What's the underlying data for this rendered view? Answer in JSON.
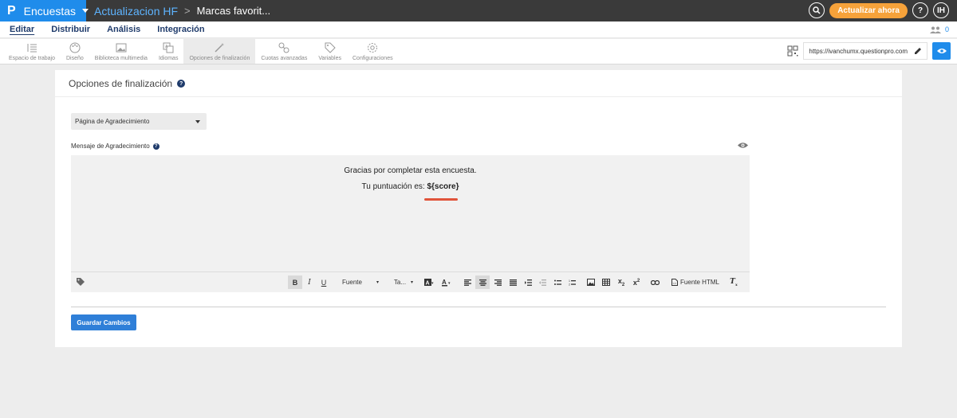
{
  "topbar": {
    "brand_logo": "P",
    "brand_name": "Encuestas",
    "breadcrumb_link": "Actualizacion HF",
    "breadcrumb_sep": ">",
    "breadcrumb_current": "Marcas favorit...",
    "search_icon": "search-icon",
    "update_label": "Actualizar ahora",
    "help_label": "?",
    "avatar_initials": "IH"
  },
  "menu": {
    "items": [
      {
        "label": "Editar",
        "active": true
      },
      {
        "label": "Distribuir",
        "active": false
      },
      {
        "label": "Análisis",
        "active": false
      },
      {
        "label": "Integración",
        "active": false
      }
    ],
    "users_count": "0"
  },
  "toolbar": {
    "tools": [
      {
        "label": "Espacio de trabajo",
        "icon": "workspace-icon"
      },
      {
        "label": "Diseño",
        "icon": "palette-icon"
      },
      {
        "label": "Biblioteca multimedia",
        "icon": "image-icon"
      },
      {
        "label": "Idiomas",
        "icon": "language-icon"
      },
      {
        "label": "Opciones de finalización",
        "icon": "wand-icon",
        "active": true
      },
      {
        "label": "Cuotas avanzadas",
        "icon": "quota-icon"
      },
      {
        "label": "Variables",
        "icon": "tag-icon"
      },
      {
        "label": "Configuraciones",
        "icon": "gear-icon"
      }
    ],
    "url": "https://ivanchumx.questionpro.com"
  },
  "panel": {
    "title": "Opciones de finalización",
    "select_value": "Página de Agradecimiento",
    "message_label": "Mensaje de Agradecimiento",
    "editor_line1": "Gracias por completar esta encuesta.",
    "editor_line2_prefix": "Tu puntuación es: ",
    "editor_line2_var": "${score}",
    "font_label": "Fuente",
    "size_label": "Ta...",
    "html_source_label": "Fuente HTML",
    "save_label": "Guardar Cambios"
  },
  "colors": {
    "brand": "#1f8ceb",
    "topbar": "#3a3a3a",
    "update_button": "#f6a23a",
    "save_button": "#2f7fd8",
    "highlight_underline": "#e0533a"
  }
}
